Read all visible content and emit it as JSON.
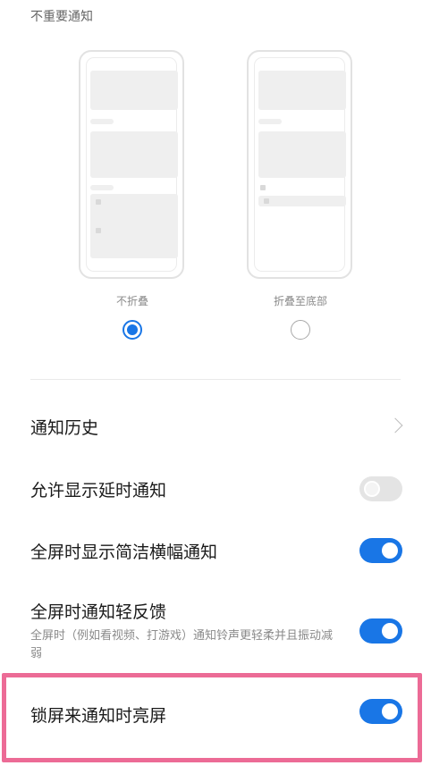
{
  "section": {
    "title": "不重要通知"
  },
  "fold_options": {
    "no_fold": {
      "label": "不折叠",
      "selected": true
    },
    "fold_bottom": {
      "label": "折叠至底部",
      "selected": false
    }
  },
  "settings": {
    "history": {
      "title": "通知历史"
    },
    "delayed": {
      "title": "允许显示延时通知",
      "enabled": false
    },
    "fullscreen_banner": {
      "title": "全屏时显示简洁横幅通知",
      "enabled": true
    },
    "fullscreen_feedback": {
      "title": "全屏时通知轻反馈",
      "subtitle": "全屏时（例如看视频、打游戏）通知铃声更轻柔并且振动减弱",
      "enabled": true
    },
    "lockscreen_wake": {
      "title": "锁屏来通知时亮屏",
      "enabled": true
    }
  },
  "colors": {
    "accent": "#1976e6",
    "highlight": "#ec6b96"
  }
}
